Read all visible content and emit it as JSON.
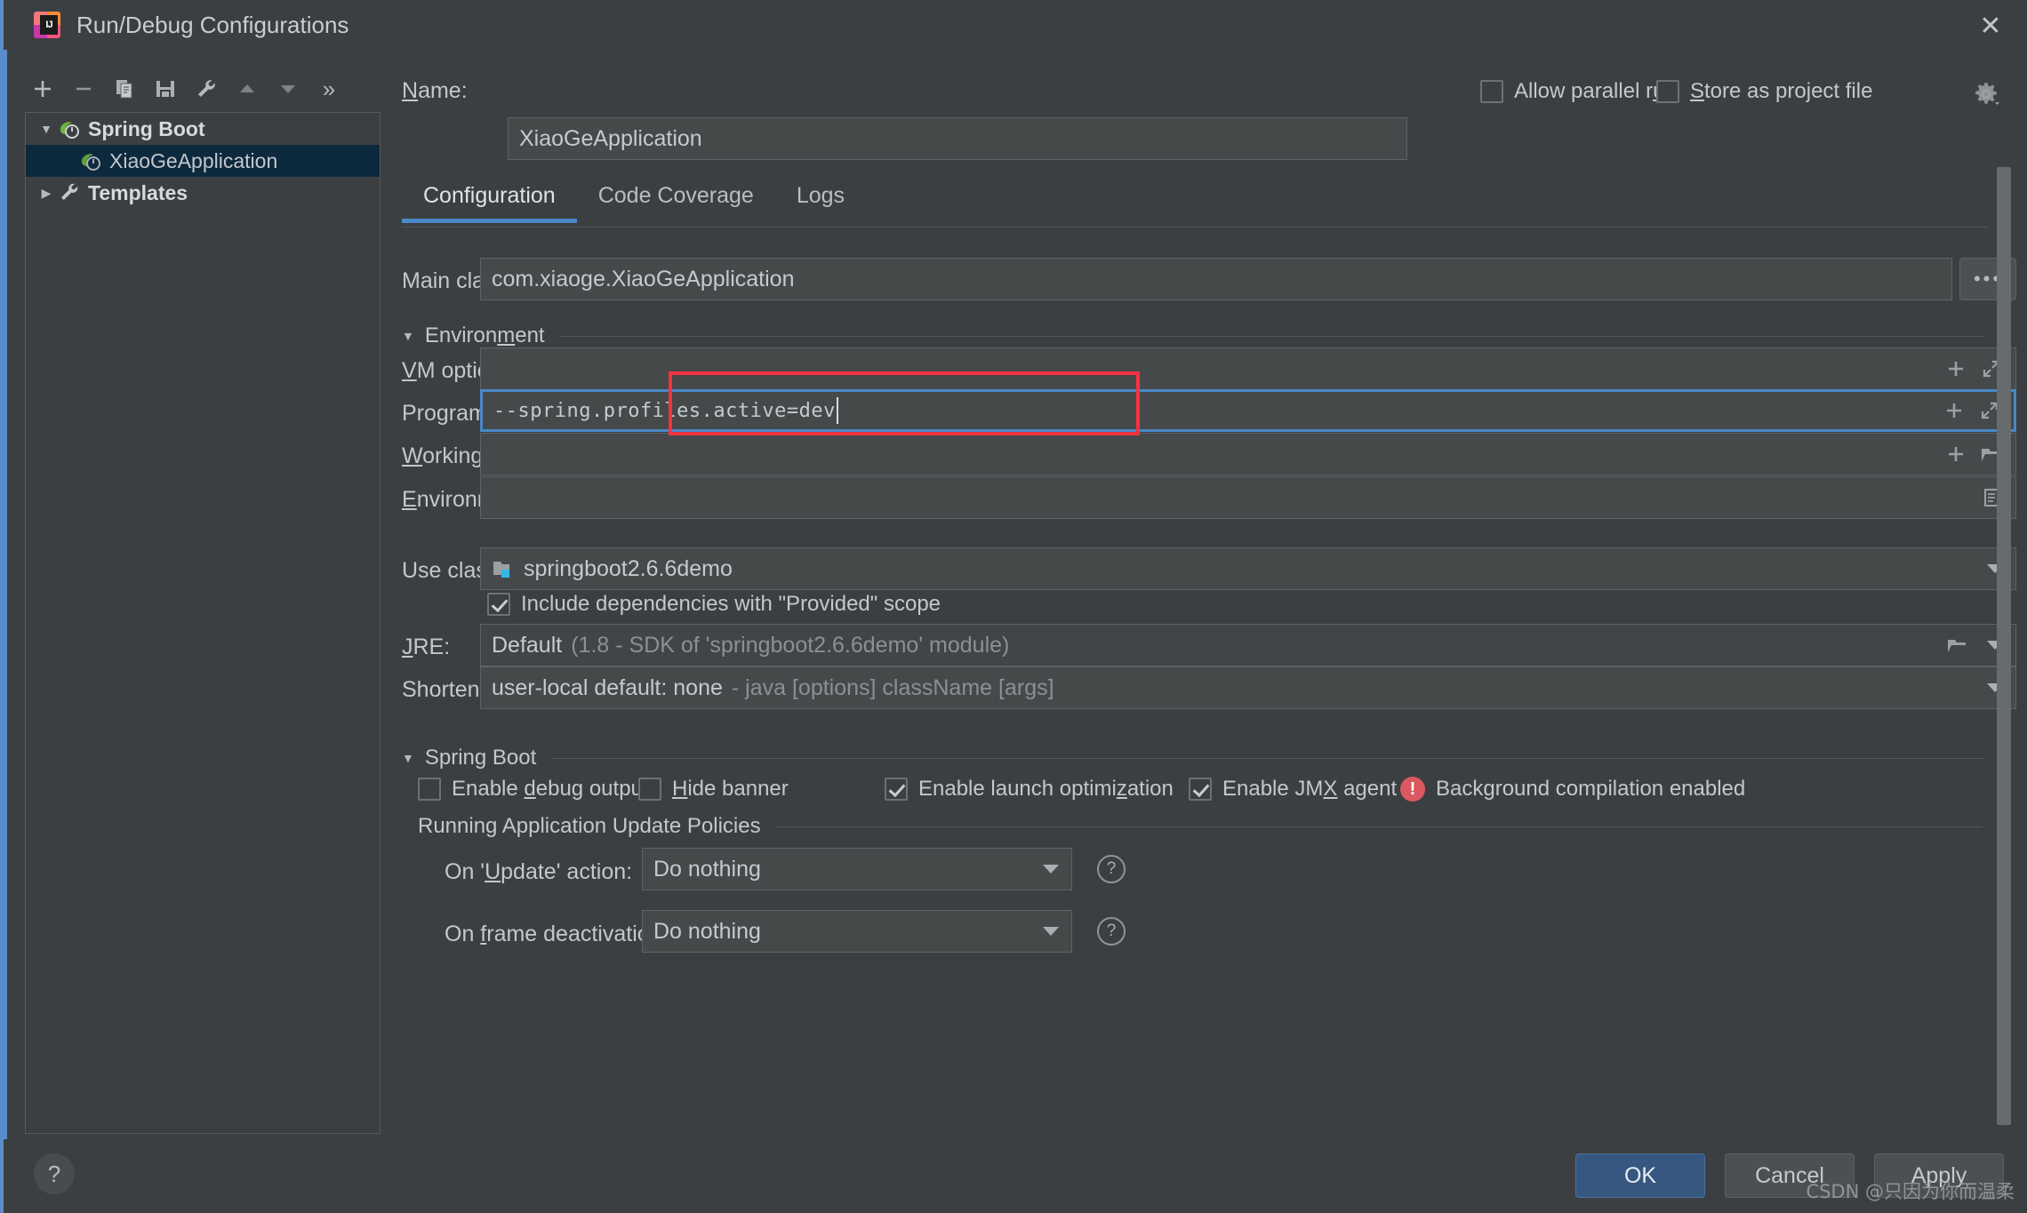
{
  "window": {
    "title": "Run/Debug Configurations",
    "logo_text": "IJ",
    "close_icon": "close-icon"
  },
  "toolbar": {
    "buttons": [
      {
        "name": "add-configuration-button",
        "icon": "plus-icon"
      },
      {
        "name": "remove-configuration-button",
        "icon": "minus-icon"
      },
      {
        "name": "copy-configuration-button",
        "icon": "copy-icon"
      },
      {
        "name": "save-configuration-button",
        "icon": "save-icon"
      },
      {
        "name": "edit-templates-button",
        "icon": "wrench-icon"
      },
      {
        "name": "move-up-button",
        "icon": "triangle-up-icon"
      },
      {
        "name": "move-down-button",
        "icon": "triangle-down-icon"
      },
      {
        "name": "more-options-button",
        "icon": "chevron-double-right-icon"
      }
    ],
    "more_label": "»"
  },
  "tree": {
    "nodes": [
      {
        "label": "Spring Boot",
        "twisty": "▼",
        "icon": "spring-boot-icon",
        "bold": true,
        "selected": false,
        "indent": 0
      },
      {
        "label": "XiaoGeApplication",
        "twisty": "",
        "icon": "spring-boot-icon",
        "bold": false,
        "selected": true,
        "indent": 1
      },
      {
        "label": "Templates",
        "twisty": "▶",
        "icon": "wrench-icon",
        "bold": true,
        "selected": false,
        "indent": 0
      }
    ]
  },
  "header": {
    "name_label": "Name:",
    "name_label_mnemonic": "N",
    "name_value": "XiaoGeApplication",
    "allow_parallel_run": {
      "label": "Allow parallel run",
      "checked": false
    },
    "store_as_project_file": {
      "label": "Store as project file",
      "checked": false
    },
    "gear_icon": "gear-icon"
  },
  "tabs": [
    {
      "label": "Configuration",
      "active": true
    },
    {
      "label": "Code Coverage",
      "active": false
    },
    {
      "label": "Logs",
      "active": false
    }
  ],
  "form": {
    "main_class": {
      "label": "Main class:",
      "value": "com.xiaoge.XiaoGeApplication",
      "browse_label": "•••"
    },
    "environment_section": {
      "label": "Environment",
      "twisty": "▼",
      "expanded": true
    },
    "vm_options": {
      "label": "VM options:",
      "value": "",
      "icons": [
        "plus-icon",
        "expand-icon"
      ]
    },
    "program_arguments": {
      "label": "Program arguments:",
      "value": "--spring.profiles.active=dev",
      "focused": true,
      "highlighted": true,
      "icons": [
        "plus-icon",
        "expand-icon"
      ]
    },
    "working_directory": {
      "label": "Working directory:",
      "value": "",
      "icons": [
        "plus-icon",
        "folder-icon"
      ]
    },
    "environment_variables": {
      "label": "Environment variables:",
      "value": "",
      "icons": [
        "list-icon"
      ]
    },
    "use_classpath_of_module": {
      "label": "Use classpath of module:",
      "value": "springboot2.6.6demo",
      "icon": "module-icon"
    },
    "include_provided_scope": {
      "label": "Include dependencies with \"Provided\" scope",
      "checked": true
    },
    "jre": {
      "label": "JRE:",
      "value": "Default",
      "hint": "(1.8 - SDK of 'springboot2.6.6demo' module)",
      "icons": [
        "folder-icon",
        "chevron-down-icon"
      ]
    },
    "shorten_command_line": {
      "label": "Shorten command line:",
      "value": "user-local default: none",
      "hint": "- java [options] className [args]"
    },
    "spring_boot_section": {
      "label": "Spring Boot",
      "twisty": "▼",
      "expanded": true
    },
    "spring_boot_checks": [
      {
        "label": "Enable debug output",
        "checked": false,
        "name": "enable-debug-output-checkbox"
      },
      {
        "label": "Hide banner",
        "checked": false,
        "name": "hide-banner-checkbox"
      },
      {
        "label": "Enable launch optimization",
        "checked": true,
        "name": "enable-launch-optimization-checkbox"
      },
      {
        "label": "Enable JMX agent",
        "checked": true,
        "name": "enable-jmx-agent-checkbox"
      }
    ],
    "background_compilation": {
      "label": "Background compilation enabled",
      "icon": "error-icon"
    },
    "update_policies_section": {
      "label": "Running Application Update Policies"
    },
    "on_update_action": {
      "label": "On 'Update' action:",
      "value": "Do nothing",
      "help_icon": "help-icon"
    },
    "on_frame_deactivation": {
      "label": "On frame deactivation:",
      "value": "Do nothing",
      "help_icon": "help-icon"
    }
  },
  "footer": {
    "help_label": "?",
    "ok_label": "OK",
    "cancel_label": "Cancel",
    "apply_label": "Apply"
  },
  "watermark": "CSDN @只因为你而温柔",
  "colors": {
    "accent": "#4a88c7",
    "highlight_red": "#f5333f",
    "ok_button": "#365880",
    "selection": "#0d293e",
    "error": "#db5860"
  }
}
